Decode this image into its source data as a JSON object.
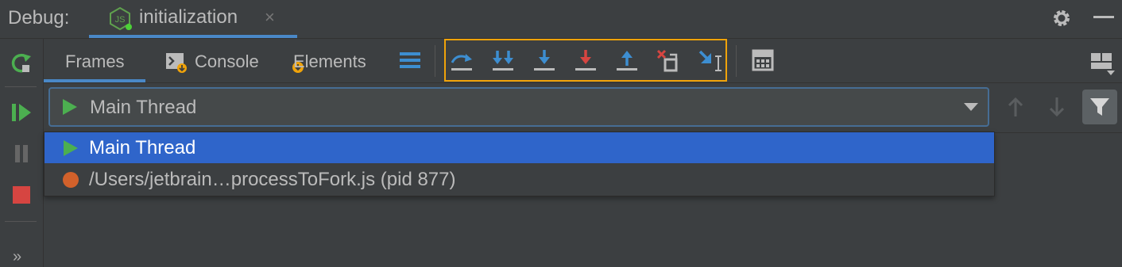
{
  "titlebar": {
    "debug_label": "Debug:",
    "tab_title": "initialization",
    "tab_icon": "nodejs-icon",
    "close_glyph": "×"
  },
  "left_toolbar": {
    "buttons": [
      "rerun-icon",
      "resume-icon",
      "pause-icon",
      "stop-icon"
    ],
    "more_glyph": "»"
  },
  "toolbar": {
    "tabs": [
      {
        "label": "Frames",
        "selected": true
      },
      {
        "label": "Console",
        "selected": false
      },
      {
        "label": "Elements",
        "selected": false
      }
    ],
    "step_buttons": [
      "step-over-icon",
      "step-into-icon",
      "smart-step-into-icon",
      "force-step-into-icon",
      "step-out-icon",
      "drop-frame-icon",
      "run-to-cursor-icon"
    ],
    "highlight_color": "#f0a30a"
  },
  "thread_selector": {
    "selected": "Main Thread"
  },
  "dropdown": {
    "items": [
      {
        "label": "Main Thread",
        "icon": "play-icon",
        "selected": true
      },
      {
        "label": "/Users/jetbrain…processToFork.js (pid 877)",
        "icon": "process-dot-icon",
        "selected": false
      }
    ]
  },
  "colors": {
    "accent": "#4a88c7",
    "selection": "#2f65ca",
    "step_blue": "#3d8ed1",
    "step_red": "#d64541",
    "run_green": "#4caf50",
    "process_orange": "#d2612b"
  }
}
